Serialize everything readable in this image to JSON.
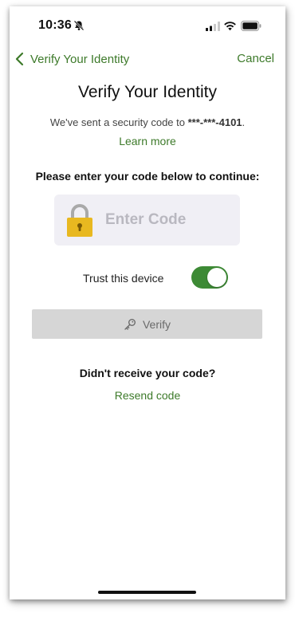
{
  "status_bar": {
    "time": "10:36"
  },
  "nav": {
    "back_label": "Verify Your Identity",
    "cancel_label": "Cancel"
  },
  "main": {
    "title": "Verify Your Identity",
    "sent_text": "We've sent a security code to ",
    "masked_phone": "***-***-4101",
    "sent_suffix": ".",
    "learn_more": "Learn more",
    "instruction": "Please enter your code below to continue:",
    "code_placeholder": "Enter Code",
    "code_value": "",
    "trust_label": "Trust this device",
    "trust_enabled": true,
    "verify_label": "Verify",
    "didnt_receive": "Didn't receive your code?",
    "resend_label": "Resend code"
  },
  "icons": {
    "back": "chevron-left-icon",
    "lock": "padlock-icon",
    "verify": "key-icon",
    "bell": "bell-slash-icon"
  },
  "colors": {
    "accent": "#3d7a2a",
    "toggle_on": "#3d8a35",
    "lock_body": "#e8b820",
    "code_box_bg": "#f0eff5",
    "verify_btn_bg": "#d6d6d6"
  }
}
